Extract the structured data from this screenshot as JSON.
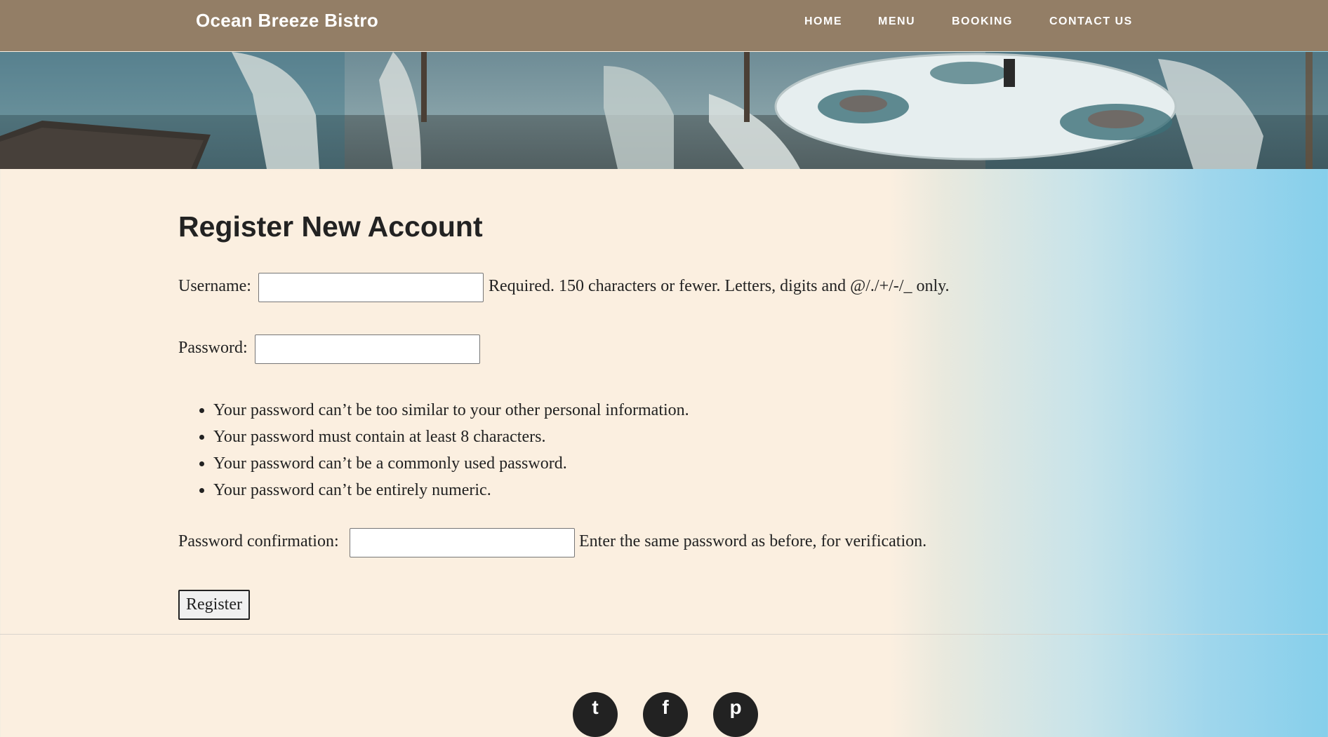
{
  "header": {
    "brand": "Ocean Breeze Bistro",
    "nav": [
      "HOME",
      "MENU",
      "BOOKING",
      "CONTACT US"
    ]
  },
  "hero": {
    "image": "restaurant-terrace-image"
  },
  "main": {
    "title": "Register New Account",
    "username": {
      "label": "Username:",
      "value": "",
      "help": "Required. 150 characters or fewer. Letters, digits and @/./+/-/_ only."
    },
    "password": {
      "label": "Password:",
      "value": ""
    },
    "password_rules": [
      "Your password can’t be too similar to your other personal information.",
      "Your password must contain at least 8 characters.",
      "Your password can’t be a commonly used password.",
      "Your password can’t be entirely numeric."
    ],
    "password_confirmation": {
      "label": "Password confirmation:",
      "value": "",
      "help": "Enter the same password as before, for verification."
    },
    "submit_label": "Register"
  },
  "footer": {
    "social_icons": [
      "twitter-icon",
      "facebook-icon",
      "pinterest-icon"
    ]
  },
  "colors": {
    "navbar": "#937e66",
    "page_background": "#fbefe0",
    "gradient_right": "#86cfeb",
    "text": "#222222"
  }
}
